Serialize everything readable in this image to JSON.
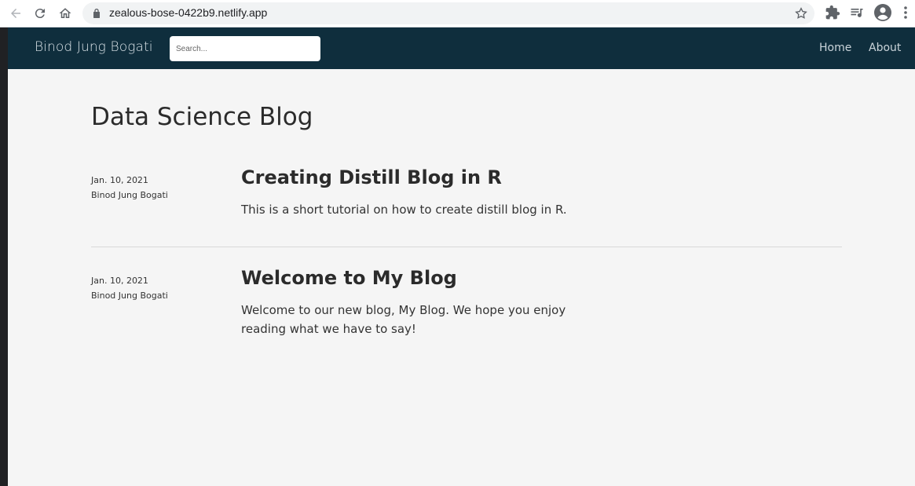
{
  "browser": {
    "url": "zealous-bose-0422b9.netlify.app"
  },
  "header": {
    "site_title": "Binod Jung Bogati",
    "search_placeholder": "Search...",
    "nav": [
      {
        "label": "Home"
      },
      {
        "label": "About"
      }
    ],
    "background_color": "#0f2e3d"
  },
  "main": {
    "heading": "Data Science Blog",
    "posts": [
      {
        "date": "Jan. 10, 2021",
        "author": "Binod Jung Bogati",
        "title": "Creating Distill Blog in R",
        "description": "This is a short tutorial on how to create distill blog in R."
      },
      {
        "date": "Jan. 10, 2021",
        "author": "Binod Jung Bogati",
        "title": "Welcome to My Blog",
        "description": "Welcome to our new blog, My Blog. We hope you enjoy reading what we have to say!"
      }
    ]
  },
  "icons": {
    "back": "arrow-left-icon",
    "reload": "reload-icon",
    "home": "home-icon",
    "lock": "lock-icon",
    "star": "star-icon",
    "extensions": "puzzle-icon",
    "media": "media-queue-icon",
    "profile": "account-icon",
    "menu": "kebab-menu-icon"
  }
}
